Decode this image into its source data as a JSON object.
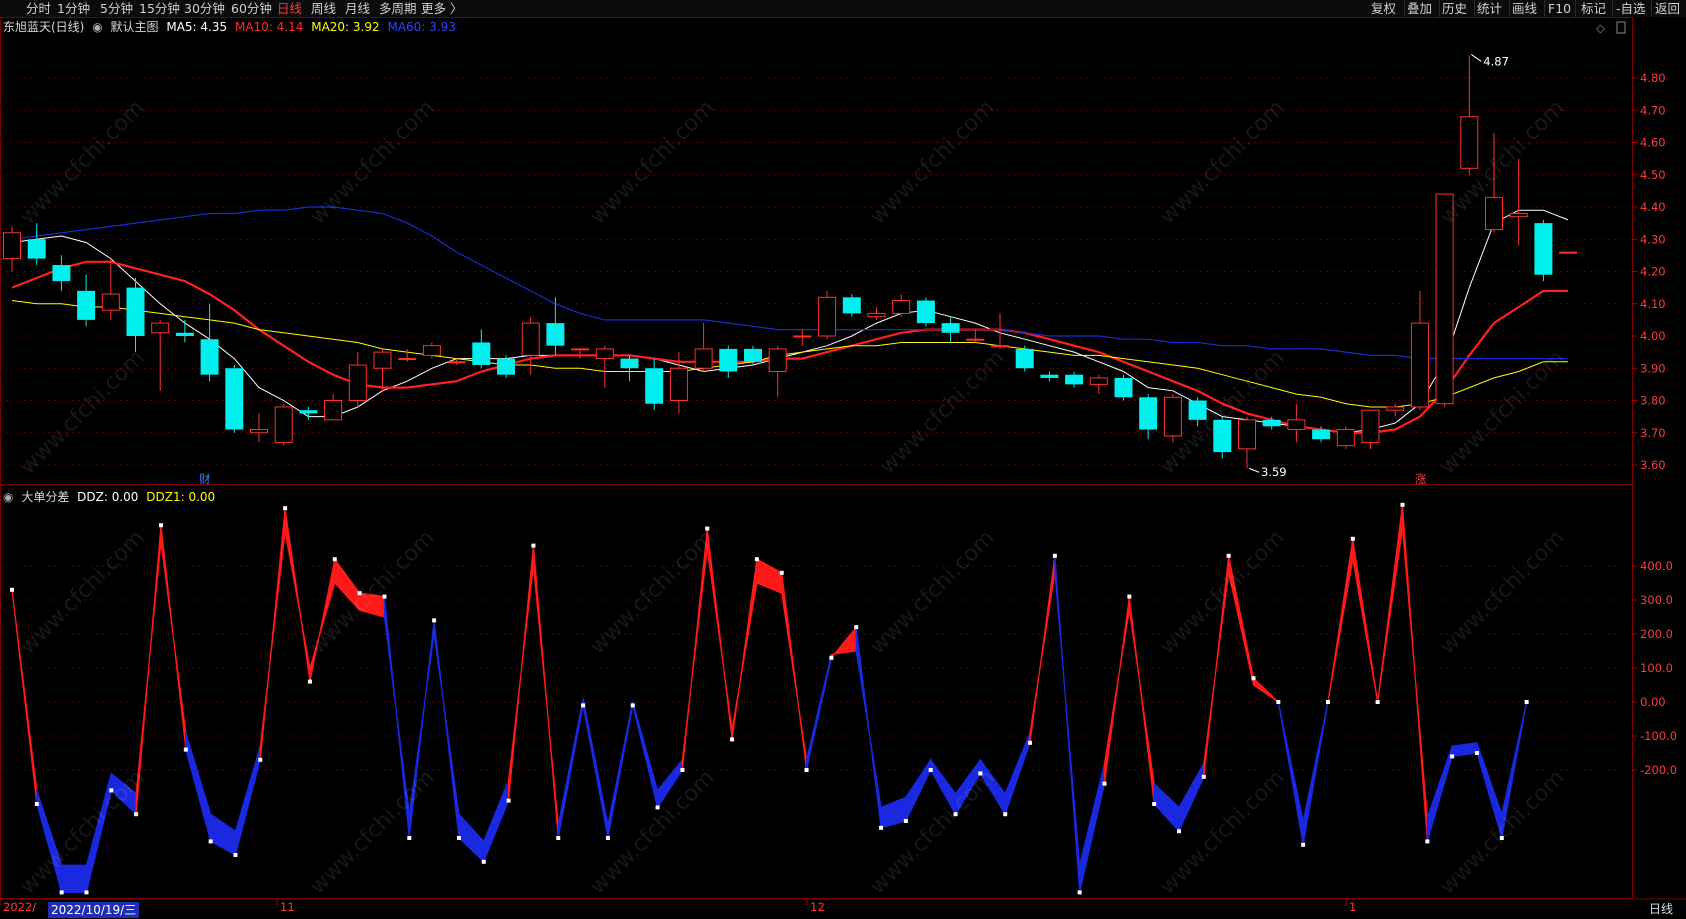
{
  "toolbar": {
    "left_items": [
      "分时",
      "1分钟",
      "5分钟",
      "15分钟",
      "30分钟",
      "60分钟",
      "日线",
      "周线",
      "月线",
      "多周期",
      "更多 〉"
    ],
    "active": "日线",
    "right_items": [
      "复权",
      "叠加",
      "历史",
      "统计",
      "画线",
      "F10",
      "标记",
      "-自选",
      "返回"
    ]
  },
  "main_legend": {
    "stock": "东旭蓝天(日线)",
    "template": "默认主图",
    "ma5": "MA5: 4.35",
    "ma10": "MA10: 4.14",
    "ma20": "MA20: 3.92",
    "ma60": "MA60: 3.93"
  },
  "sub_legend": {
    "name": "大单分差",
    "ddz": "DDZ: 0.00",
    "ddz1": "DDZ1: 0.00"
  },
  "markers": {
    "high": "4.87",
    "low": "3.59",
    "fin_tag": "财",
    "limit_up_tag": "涨"
  },
  "xaxis": {
    "labels": [
      "2022/",
      "11",
      "12",
      "1"
    ],
    "cursor_date": "2022/10/19/三",
    "period": "日线"
  },
  "watermark": "www.cfchi.com",
  "colors": {
    "up": "#ff3030",
    "down": "#00f0f0",
    "ma5": "#ffffff",
    "ma10": "#ff2020",
    "ma20": "#ffff00",
    "ma60": "#1a2cd0",
    "ddz_pos": "#ff1a1a",
    "ddz_neg": "#1a28e0",
    "grid": "#5a0000"
  },
  "chart_data": [
    {
      "type": "candlestick",
      "title": "东旭蓝天(日线)",
      "ylim": [
        3.55,
        4.9
      ],
      "yticks": [
        "4.80",
        "4.70",
        "4.60",
        "4.50",
        "4.40",
        "4.30",
        "4.20",
        "4.10",
        "4.00",
        "3.90",
        "3.80",
        "3.70",
        "3.60"
      ],
      "candles": [
        [
          4.24,
          4.32,
          4.2,
          4.34
        ],
        [
          4.3,
          4.24,
          4.22,
          4.35
        ],
        [
          4.22,
          4.17,
          4.14,
          4.25
        ],
        [
          4.14,
          4.05,
          4.03,
          4.19
        ],
        [
          4.08,
          4.13,
          4.05,
          4.24
        ],
        [
          4.15,
          4.0,
          3.95,
          4.18
        ],
        [
          4.01,
          4.04,
          3.83,
          4.05
        ],
        [
          4.01,
          4.0,
          3.98,
          4.05
        ],
        [
          3.99,
          3.88,
          3.86,
          4.1
        ],
        [
          3.9,
          3.71,
          3.7,
          3.91
        ],
        [
          3.7,
          3.71,
          3.67,
          3.76
        ],
        [
          3.67,
          3.78,
          3.66,
          3.79
        ],
        [
          3.77,
          3.76,
          3.74,
          3.78
        ],
        [
          3.74,
          3.8,
          3.74,
          3.82
        ],
        [
          3.8,
          3.91,
          3.78,
          3.95
        ],
        [
          3.9,
          3.95,
          3.83,
          3.96
        ],
        [
          3.93,
          3.93,
          3.92,
          3.96
        ],
        [
          3.94,
          3.97,
          3.93,
          3.98
        ],
        [
          3.92,
          3.92,
          3.91,
          3.93
        ],
        [
          3.98,
          3.91,
          3.9,
          4.02
        ],
        [
          3.93,
          3.88,
          3.87,
          3.94
        ],
        [
          3.94,
          4.04,
          3.88,
          4.06
        ],
        [
          4.04,
          3.97,
          3.94,
          4.12
        ],
        [
          3.96,
          3.96,
          3.93,
          3.96
        ],
        [
          3.93,
          3.96,
          3.84,
          3.97
        ],
        [
          3.93,
          3.9,
          3.86,
          3.94
        ],
        [
          3.9,
          3.79,
          3.77,
          3.93
        ],
        [
          3.8,
          3.9,
          3.76,
          3.95
        ],
        [
          3.9,
          3.96,
          3.89,
          4.04
        ],
        [
          3.96,
          3.89,
          3.87,
          3.97
        ],
        [
          3.96,
          3.92,
          3.91,
          3.97
        ],
        [
          3.89,
          3.96,
          3.81,
          3.97
        ],
        [
          4.0,
          4.0,
          3.97,
          4.02
        ],
        [
          4.0,
          4.12,
          3.99,
          4.14
        ],
        [
          4.12,
          4.07,
          4.06,
          4.13
        ],
        [
          4.06,
          4.07,
          4.05,
          4.09
        ],
        [
          4.07,
          4.11,
          4.06,
          4.13
        ],
        [
          4.11,
          4.04,
          4.03,
          4.12
        ],
        [
          4.04,
          4.01,
          3.98,
          4.06
        ],
        [
          3.99,
          3.99,
          3.98,
          4.02
        ],
        [
          3.97,
          3.97,
          3.96,
          4.07
        ],
        [
          3.96,
          3.9,
          3.89,
          3.97
        ],
        [
          3.88,
          3.87,
          3.86,
          3.89
        ],
        [
          3.88,
          3.85,
          3.84,
          3.89
        ],
        [
          3.85,
          3.87,
          3.82,
          3.88
        ],
        [
          3.87,
          3.81,
          3.8,
          3.88
        ],
        [
          3.81,
          3.71,
          3.68,
          3.82
        ],
        [
          3.69,
          3.81,
          3.67,
          3.82
        ],
        [
          3.8,
          3.74,
          3.72,
          3.81
        ],
        [
          3.74,
          3.64,
          3.62,
          3.75
        ],
        [
          3.65,
          3.74,
          3.59,
          3.75
        ],
        [
          3.74,
          3.72,
          3.71,
          3.75
        ],
        [
          3.71,
          3.74,
          3.67,
          3.79
        ],
        [
          3.71,
          3.68,
          3.67,
          3.72
        ],
        [
          3.66,
          3.71,
          3.65,
          3.72
        ],
        [
          3.67,
          3.77,
          3.65,
          3.77
        ],
        [
          3.77,
          3.78,
          3.75,
          3.79
        ],
        [
          3.78,
          4.04,
          3.77,
          4.14
        ],
        [
          3.79,
          4.44,
          3.78,
          4.44
        ],
        [
          4.52,
          4.68,
          4.5,
          4.87
        ],
        [
          4.33,
          4.43,
          4.32,
          4.63
        ],
        [
          4.37,
          4.38,
          4.28,
          4.55
        ],
        [
          4.35,
          4.19,
          4.17,
          4.36
        ],
        [
          4.26,
          4.26,
          4.26,
          4.26
        ]
      ],
      "series": [
        {
          "name": "MA5",
          "values": [
            4.29,
            4.3,
            4.31,
            4.29,
            4.24,
            4.17,
            4.1,
            4.04,
            3.99,
            3.93,
            3.84,
            3.8,
            3.75,
            3.75,
            3.78,
            3.83,
            3.86,
            3.9,
            3.93,
            3.93,
            3.93,
            3.94,
            3.94,
            3.94,
            3.94,
            3.94,
            3.93,
            3.91,
            3.89,
            3.9,
            3.91,
            3.93,
            3.95,
            3.97,
            4.0,
            4.04,
            4.07,
            4.08,
            4.06,
            4.04,
            4.01,
            3.99,
            3.97,
            3.95,
            3.92,
            3.89,
            3.84,
            3.83,
            3.79,
            3.75,
            3.74,
            3.73,
            3.72,
            3.71,
            3.7,
            3.71,
            3.73,
            3.79,
            3.92,
            4.15,
            4.35,
            4.39,
            4.39,
            4.36
          ]
        },
        {
          "name": "MA10",
          "values": [
            4.15,
            4.18,
            4.21,
            4.23,
            4.23,
            4.21,
            4.19,
            4.17,
            4.13,
            4.08,
            4.02,
            3.97,
            3.92,
            3.88,
            3.85,
            3.84,
            3.84,
            3.85,
            3.86,
            3.89,
            3.91,
            3.93,
            3.94,
            3.94,
            3.94,
            3.94,
            3.93,
            3.92,
            3.92,
            3.92,
            3.92,
            3.93,
            3.93,
            3.95,
            3.97,
            3.99,
            4.01,
            4.02,
            4.02,
            4.02,
            4.02,
            4.01,
            3.99,
            3.97,
            3.95,
            3.92,
            3.89,
            3.86,
            3.83,
            3.79,
            3.76,
            3.74,
            3.72,
            3.71,
            3.7,
            3.7,
            3.71,
            3.75,
            3.83,
            3.94,
            4.04,
            4.09,
            4.14,
            4.14
          ]
        },
        {
          "name": "MA20",
          "values": [
            4.11,
            4.1,
            4.1,
            4.09,
            4.09,
            4.08,
            4.07,
            4.06,
            4.05,
            4.04,
            4.02,
            4.01,
            4.0,
            3.99,
            3.98,
            3.96,
            3.95,
            3.94,
            3.93,
            3.92,
            3.91,
            3.91,
            3.9,
            3.9,
            3.89,
            3.89,
            3.89,
            3.89,
            3.9,
            3.91,
            3.92,
            3.94,
            3.95,
            3.96,
            3.97,
            3.97,
            3.98,
            3.98,
            3.98,
            3.98,
            3.97,
            3.96,
            3.95,
            3.94,
            3.94,
            3.93,
            3.92,
            3.91,
            3.9,
            3.88,
            3.86,
            3.84,
            3.82,
            3.81,
            3.79,
            3.78,
            3.78,
            3.79,
            3.81,
            3.84,
            3.87,
            3.89,
            3.92,
            3.92
          ]
        },
        {
          "name": "MA60",
          "values": [
            4.3,
            4.31,
            4.32,
            4.33,
            4.34,
            4.35,
            4.36,
            4.37,
            4.38,
            4.38,
            4.39,
            4.39,
            4.4,
            4.4,
            4.39,
            4.38,
            4.35,
            4.31,
            4.26,
            4.22,
            4.18,
            4.14,
            4.1,
            4.07,
            4.05,
            4.05,
            4.05,
            4.05,
            4.05,
            4.04,
            4.03,
            4.02,
            4.02,
            4.02,
            4.02,
            4.02,
            4.02,
            4.02,
            4.02,
            4.02,
            4.02,
            4.01,
            4.0,
            4.0,
            4.0,
            3.99,
            3.99,
            3.98,
            3.98,
            3.97,
            3.97,
            3.96,
            3.96,
            3.96,
            3.95,
            3.94,
            3.94,
            3.93,
            3.93,
            3.93,
            3.93,
            3.93,
            3.93,
            3.93
          ]
        }
      ]
    },
    {
      "type": "area",
      "title": "大单分差",
      "ylim": [
        -600,
        600
      ],
      "yticks": [
        "400.0",
        "300.0",
        "200.0",
        "100.0",
        "0.00",
        "-100.0",
        "-200.0"
      ],
      "series": [
        {
          "name": "DDZ",
          "values": [
            330,
            -300,
            -560,
            -560,
            -260,
            -330,
            520,
            -140,
            -410,
            -450,
            -170,
            570,
            60,
            420,
            320,
            310,
            -400,
            240,
            -400,
            -470,
            -290,
            460,
            -400,
            -10,
            -400,
            -10,
            -310,
            -200,
            510,
            -110,
            420,
            380,
            -200,
            130,
            220,
            -370,
            -350,
            -200,
            -330,
            -210,
            -330,
            -120,
            430,
            -560,
            -240,
            310,
            -300,
            -380,
            -220,
            430,
            70,
            0,
            -420,
            0,
            480,
            0,
            580,
            -410,
            -160,
            -150,
            -400,
            0
          ]
        },
        {
          "name": "DDZ1",
          "values": [
            330,
            -260,
            -480,
            -480,
            -210,
            -270,
            470,
            -90,
            -330,
            -380,
            -130,
            500,
            100,
            350,
            270,
            250,
            -330,
            200,
            -330,
            -410,
            -230,
            400,
            -360,
            10,
            -360,
            0,
            -260,
            -170,
            450,
            -80,
            350,
            320,
            -170,
            140,
            150,
            -310,
            -280,
            -170,
            -270,
            -170,
            -270,
            -90,
            380,
            -480,
            -180,
            270,
            -240,
            -310,
            -180,
            380,
            50,
            0,
            -350,
            0,
            420,
            0,
            510,
            -340,
            -130,
            -120,
            -330,
            0
          ]
        }
      ]
    }
  ]
}
